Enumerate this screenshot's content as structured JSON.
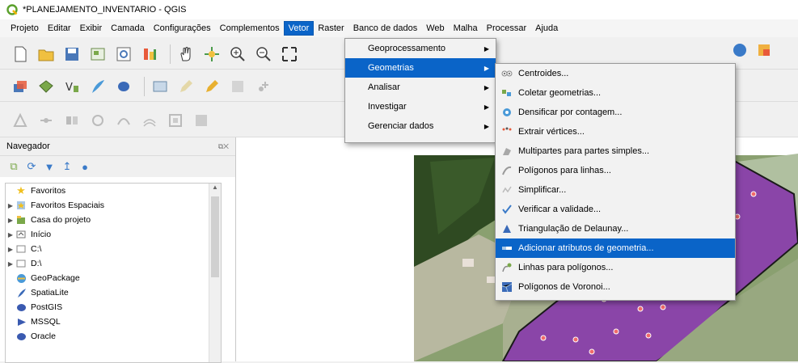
{
  "window": {
    "title": "*PLANEJAMENTO_INVENTARIO - QGIS"
  },
  "menubar": {
    "items": [
      "Projeto",
      "Editar",
      "Exibir",
      "Camada",
      "Configurações",
      "Complementos",
      "Vetor",
      "Raster",
      "Banco de dados",
      "Web",
      "Malha",
      "Processar",
      "Ajuda"
    ],
    "active_index": 6
  },
  "vector_menu": {
    "items": [
      {
        "label": "Geoprocessamento",
        "submenu": true
      },
      {
        "label": "Geometrias",
        "submenu": true,
        "selected": true
      },
      {
        "label": "Analisar",
        "submenu": true
      },
      {
        "label": "Investigar",
        "submenu": true
      },
      {
        "label": "Gerenciar dados",
        "submenu": true
      }
    ]
  },
  "geometry_menu": {
    "items": [
      {
        "label": "Centroides...",
        "icon": "centroids-icon"
      },
      {
        "label": "Coletar geometrias...",
        "icon": "collect-geometries-icon"
      },
      {
        "label": "Densificar por contagem...",
        "icon": "densify-icon"
      },
      {
        "label": "Extrair vértices...",
        "icon": "extract-vertices-icon"
      },
      {
        "label": "Multipartes para partes simples...",
        "icon": "multipart-icon"
      },
      {
        "label": "Polígonos para linhas...",
        "icon": "polygons-to-lines-icon"
      },
      {
        "label": "Simplificar...",
        "icon": "simplify-icon"
      },
      {
        "label": "Verificar a validade...",
        "icon": "check-validity-icon"
      },
      {
        "label": "Triangulação de Delaunay...",
        "icon": "delaunay-icon"
      },
      {
        "label": "Adicionar atributos de geometria...",
        "icon": "add-geometry-attributes-icon",
        "selected": true
      },
      {
        "label": "Linhas para polígonos...",
        "icon": "lines-to-polygons-icon"
      },
      {
        "label": "Polígonos de Voronoi...",
        "icon": "voronoi-icon"
      }
    ]
  },
  "browser": {
    "title": "Navegador",
    "items": [
      {
        "label": "Favoritos",
        "icon": "star-icon",
        "expandable": false
      },
      {
        "label": "Favoritos Espaciais",
        "icon": "spatial-bookmarks-icon",
        "expandable": true
      },
      {
        "label": "Casa do projeto",
        "icon": "project-home-icon",
        "expandable": true
      },
      {
        "label": "Início",
        "icon": "home-folder-icon",
        "expandable": true
      },
      {
        "label": "C:\\",
        "icon": "drive-icon",
        "expandable": true
      },
      {
        "label": "D:\\",
        "icon": "drive-icon",
        "expandable": true
      },
      {
        "label": "GeoPackage",
        "icon": "geopackage-icon",
        "expandable": false
      },
      {
        "label": "SpatiaLite",
        "icon": "spatialite-icon",
        "expandable": false
      },
      {
        "label": "PostGIS",
        "icon": "postgis-icon",
        "expandable": false
      },
      {
        "label": "MSSQL",
        "icon": "mssql-icon",
        "expandable": false
      },
      {
        "label": "Oracle",
        "icon": "oracle-icon",
        "expandable": false
      }
    ]
  },
  "colors": {
    "selection": "#0a64c8",
    "polygon_fill": "#8a45a8",
    "point_fill": "#f06a6a"
  }
}
